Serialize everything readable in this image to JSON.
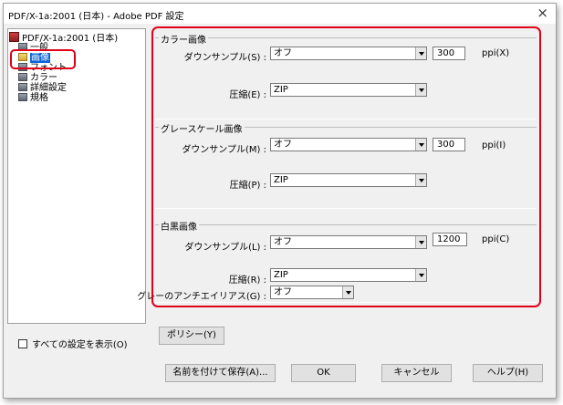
{
  "window": {
    "title": "PDF/X-1a:2001 (日本) - Adobe PDF 設定",
    "close_label": "×"
  },
  "tree": {
    "root": "PDF/X-1a:2001 (日本)",
    "items": [
      {
        "label": "一般",
        "selected": false
      },
      {
        "label": "画像",
        "selected": true
      },
      {
        "label": "フォント",
        "selected": false
      },
      {
        "label": "カラー",
        "selected": false
      },
      {
        "label": "詳細設定",
        "selected": false
      },
      {
        "label": "規格",
        "selected": false
      }
    ]
  },
  "color_images": {
    "group_label": "カラー画像",
    "downsample_label": "ダウンサンプル(S) :",
    "downsample_value": "オフ",
    "resolution": "300",
    "unit": "ppi(X)",
    "compression_label": "圧縮(E) :",
    "compression_value": "ZIP"
  },
  "gray_images": {
    "group_label": "グレースケール画像",
    "downsample_label": "ダウンサンプル(M) :",
    "downsample_value": "オフ",
    "resolution": "300",
    "unit": "ppi(I)",
    "compression_label": "圧縮(P) :",
    "compression_value": "ZIP"
  },
  "mono_images": {
    "group_label": "白黒画像",
    "downsample_label": "ダウンサンプル(L) :",
    "downsample_value": "オフ",
    "resolution": "1200",
    "unit": "ppi(C)",
    "compression_label": "圧縮(R) :",
    "compression_value": "ZIP",
    "antialias_label": "グレーのアンチエイリアス(G) :",
    "antialias_value": "オフ"
  },
  "footer": {
    "show_all_label": "すべての設定を表示(O)",
    "policy_button": "ポリシー(Y)",
    "save_as_button": "名前を付けて保存(A)...",
    "ok_button": "OK",
    "cancel_button": "キャンセル",
    "help_button": "ヘルプ(H)"
  },
  "colors": {
    "accent": "#e0001a",
    "selection": "#0a64d8"
  }
}
